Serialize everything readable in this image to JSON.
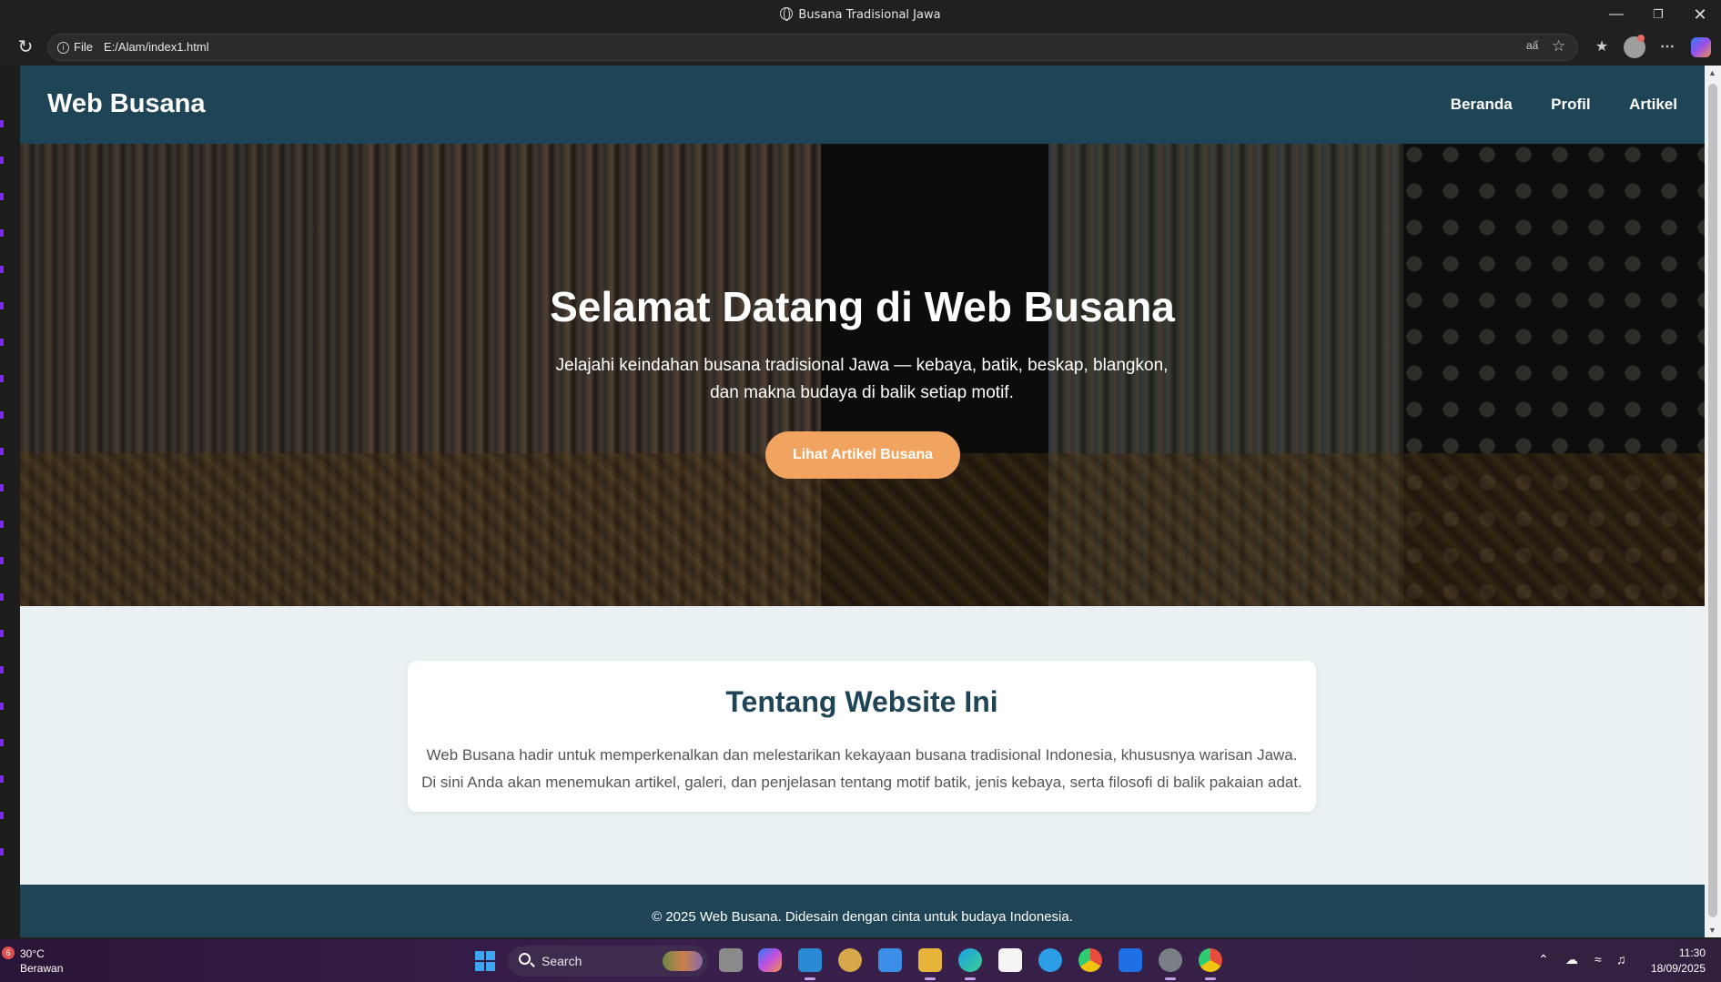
{
  "window": {
    "title": "Busana Tradisional Jawa"
  },
  "address_bar": {
    "protocol_label": "File",
    "url": "E:/Alam/index1.html"
  },
  "site": {
    "brand": "Web Busana",
    "nav": [
      "Beranda",
      "Profil",
      "Artikel"
    ],
    "hero": {
      "title": "Selamat Datang di Web Busana",
      "subtitle_line1": "Jelajahi keindahan busana tradisional Jawa — kebaya, batik, beskap, blangkon,",
      "subtitle_line2": "dan makna budaya di balik setiap motif.",
      "cta": "Lihat Artikel Busana"
    },
    "about": {
      "title": "Tentang Website Ini",
      "line1": "Web Busana hadir untuk memperkenalkan dan melestarikan kekayaan busana tradisional Indonesia, khususnya warisan Jawa.",
      "line2": "Di sini Anda akan menemukan artikel, galeri, dan penjelasan tentang motif batik, jenis kebaya, serta filosofi di balik pakaian adat."
    },
    "footer": "© 2025 Web Busana. Didesain dengan cinta untuk budaya Indonesia.",
    "colors": {
      "primary": "#1e4456",
      "accent": "#f0a45f",
      "background": "#e9f1f3"
    }
  },
  "taskbar": {
    "weather": {
      "badge": "6",
      "temp": "30°C",
      "condition": "Berawan"
    },
    "search_label": "Search",
    "time": "11:30",
    "date": "18/09/2025"
  }
}
